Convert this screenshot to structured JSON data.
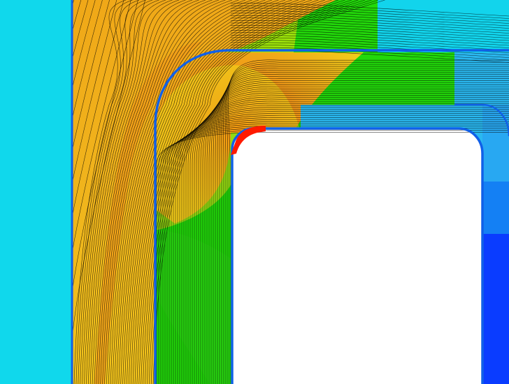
{
  "view": {
    "colormap": {
      "cyan": "#10d8ec",
      "light_blue": "#28b8f0",
      "blue": "#0a3cff",
      "green": "#22d80a",
      "lime": "#a4ea0a",
      "yellow": "#f2ea1a",
      "orange": "#f0a018",
      "deep_orange": "#ec6a14",
      "red": "#ff1a00",
      "white": "#ffffff"
    },
    "contour_line_color": "#000000",
    "boundary_color": "#1060e8",
    "hotspot_marker_color": "#ff1a00",
    "axes": "none",
    "legend": "none",
    "grid": false
  }
}
